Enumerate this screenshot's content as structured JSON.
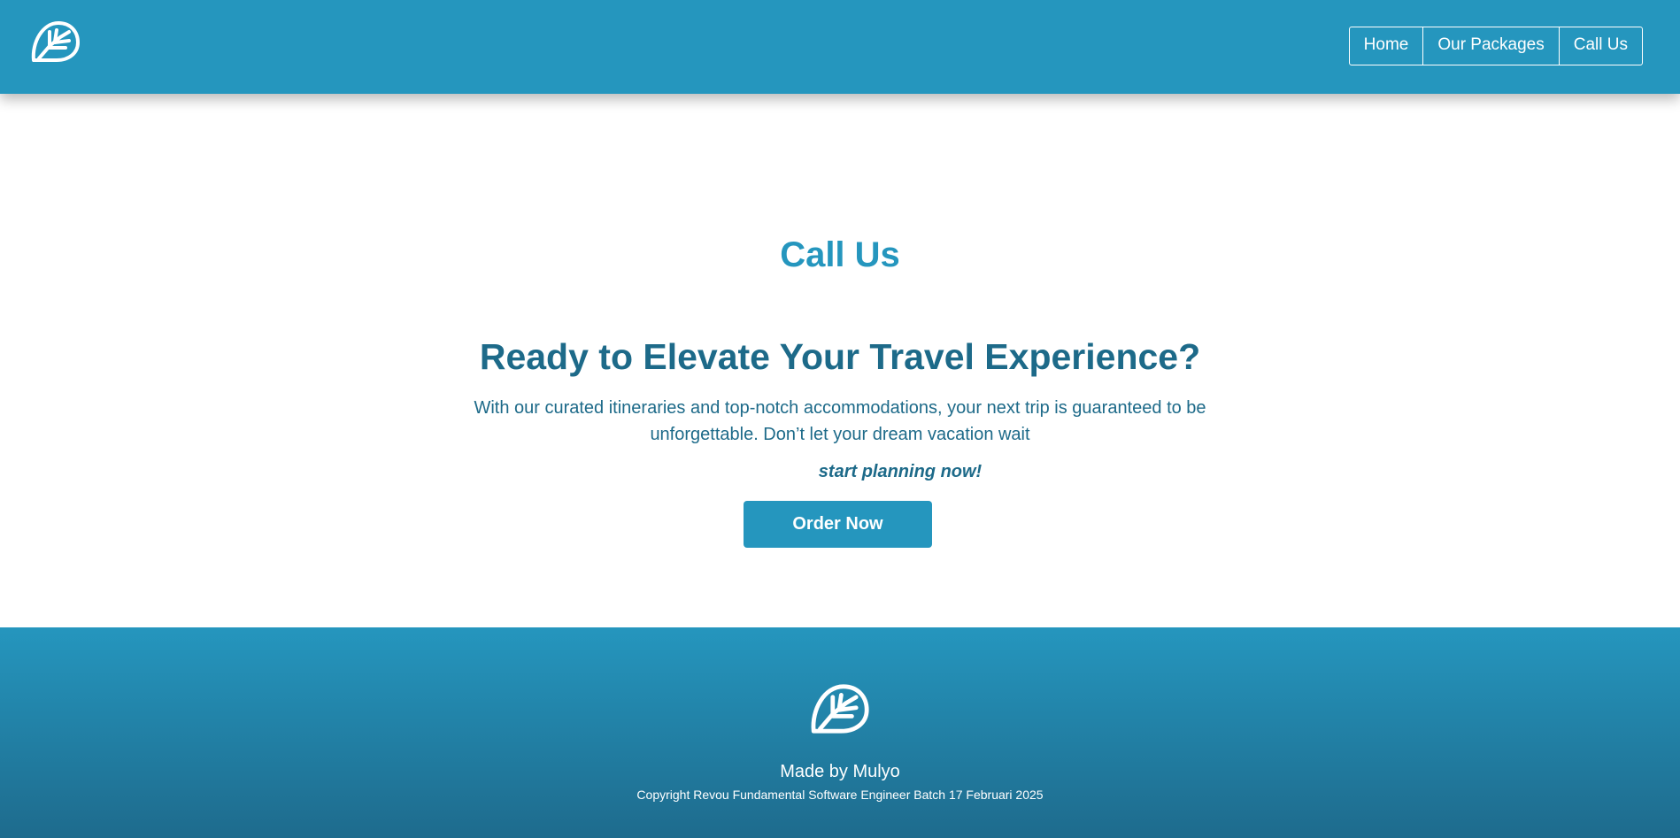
{
  "header": {
    "logo": "leaf-logo-icon",
    "nav": [
      {
        "label": "Home"
      },
      {
        "label": "Our Packages"
      },
      {
        "label": "Call Us"
      }
    ]
  },
  "main": {
    "section_title": "Call Us",
    "headline": "Ready to Elevate Your Travel Experience?",
    "description": "With our curated itineraries and top-notch accommodations, your next trip is guaranteed to be unforgettable. Don’t let your dream vacation wait",
    "cta_text": "start planning now!",
    "order_button": "Order Now"
  },
  "footer": {
    "logo": "leaf-logo-icon",
    "made_by": "Made by Mulyo",
    "copyright": "Copyright Revou Fundamental Software Engineer Batch 17 Februari 2025"
  },
  "colors": {
    "brand": "#2596be",
    "heading_dark": "#1d6a89",
    "footer_gradient_end": "#1e6b8d",
    "text_on_brand": "#ffffff"
  }
}
